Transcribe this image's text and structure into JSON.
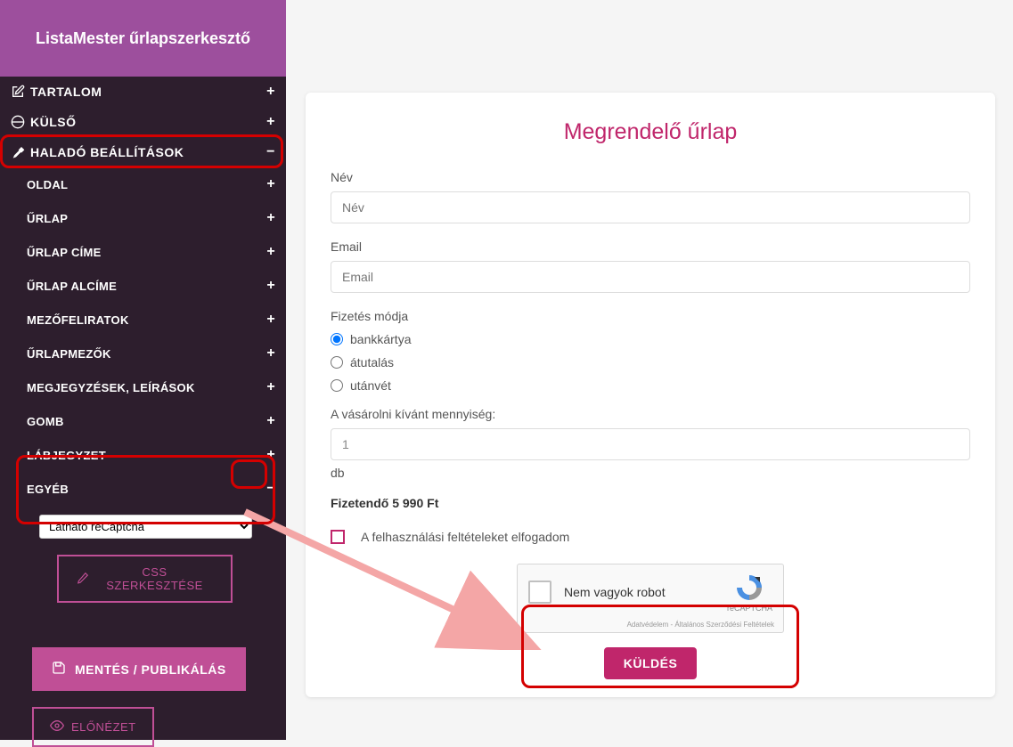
{
  "header": {
    "title": "ListaMester űrlapszerkesztő"
  },
  "nav": {
    "tartalom": "TARTALOM",
    "kulso": "KÜLSŐ",
    "halado": "HALADÓ BEÁLLÍTÁSOK"
  },
  "sub": {
    "oldal": "OLDAL",
    "urlap": "ŰRLAP",
    "urlap_cime": "ŰRLAP CÍME",
    "urlap_alcime": "ŰRLAP ALCÍME",
    "mezofeliratok": "MEZŐFELIRATOK",
    "urlapmezok": "ŰRLAPMEZŐK",
    "megjegyzesek": "MEGJEGYZÉSEK, LEÍRÁSOK",
    "gomb": "GOMB",
    "labjegyzet": "LÁBJEGYZET",
    "egyeb": "EGYÉB"
  },
  "select": {
    "recaptcha": "Látható reCaptcha"
  },
  "buttons": {
    "css_edit": "CSS SZERKESZTÉSE",
    "save": "MENTÉS / PUBLIKÁLÁS",
    "preview": "ELŐNÉZET"
  },
  "form": {
    "title": "Megrendelő űrlap",
    "name_label": "Név",
    "name_placeholder": "Név",
    "email_label": "Email",
    "email_placeholder": "Email",
    "payment_label": "Fizetés módja",
    "payment_bank": "bankkártya",
    "payment_transfer": "átutalás",
    "payment_cod": "utánvét",
    "qty_label": "A vásárolni kívánt mennyiség:",
    "qty_value": "1",
    "qty_unit": "db",
    "total": "Fizetendő 5 990 Ft",
    "terms": "A felhasználási feltételeket elfogadom",
    "captcha_text": "Nem vagyok robot",
    "captcha_brand": "reCAPTCHA",
    "captcha_links": "Adatvédelem - Általános Szerződési Feltételek",
    "submit": "KÜLDÉS"
  }
}
